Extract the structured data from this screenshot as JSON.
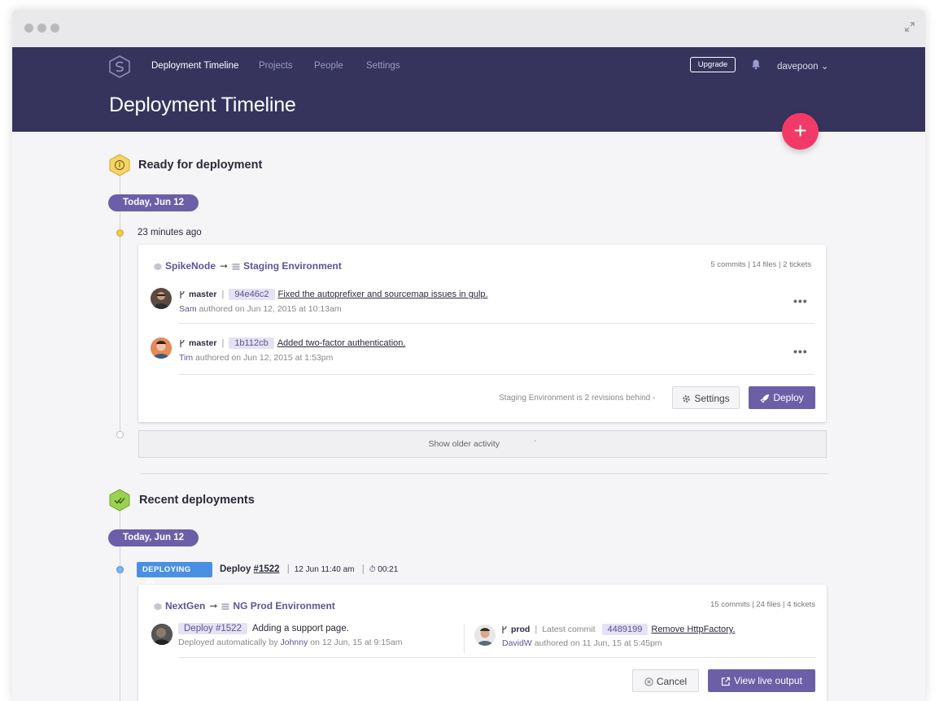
{
  "nav": {
    "items": [
      "Deployment Timeline",
      "Projects",
      "People",
      "Settings"
    ],
    "upgrade": "Upgrade",
    "user": "davepoon ⌄"
  },
  "page": {
    "title": "Deployment Timeline",
    "fab": "+"
  },
  "ready": {
    "title": "Ready for deployment",
    "date": "Today, Jun 12",
    "time_ago": "23 minutes ago",
    "card": {
      "source": "SpikeNode",
      "arrow": "➞",
      "target": "Staging Environment",
      "stats": "5 commits | 14 files | 2 tickets",
      "commits": [
        {
          "branch": "master",
          "sep": "|",
          "hash": "94e46c2",
          "message": "Fixed the autoprefixer and sourcemap issues in gulp.",
          "author": "Sam",
          "authored": "authored on Jun 12, 2015 at 10:13am"
        },
        {
          "branch": "master",
          "sep": "|",
          "hash": "1b112cb",
          "message": "Added two-factor authentication.",
          "author": "Tim",
          "authored": "authored on Jun 12, 2015 at 1:53pm"
        }
      ],
      "more": "•••",
      "behind": "Staging Environment is 2 revisions behind",
      "behind_arrow": "-",
      "settings_label": "Settings",
      "deploy_label": "Deploy"
    },
    "older": "Show older activity",
    "older_mark": "`"
  },
  "recent": {
    "title": "Recent deployments",
    "date": "Today, Jun 12",
    "status": "DEPLOYING",
    "deploy_prefix": "Deploy",
    "deploy_id": "#1522",
    "sep": "|",
    "date_time": "12  Jun 11:40 am",
    "duration": "⏱ 00:21",
    "card": {
      "source": "NextGen",
      "arrow": "➞",
      "target": "NG Prod Environment",
      "stats": "15 commits | 24 files | 4 tickets",
      "deploy_tag": "Deploy #1522",
      "deploy_msg": "Adding a support page.",
      "deploy_meta_pre": "Deployed automatically by",
      "deploy_meta_who": "Johnny",
      "deploy_meta_post": "on 12 Jun, 15 at 9:15am",
      "branch": "prod",
      "sep": "|",
      "latest_label": "Latest commit",
      "hash": "4489199",
      "commit_msg": "Remove HttpFactory.",
      "author": "DavidW",
      "authored": "authored on 11 Jun, 15 at 5:45pm",
      "cancel_label": "Cancel",
      "live_label": "View live output"
    }
  },
  "colors": {
    "header": "#36345d",
    "accent": "#6c5fa7",
    "fab": "#f23a68",
    "deploying": "#4a90e2",
    "warning": "#f5c842",
    "success": "#8cc63f"
  }
}
